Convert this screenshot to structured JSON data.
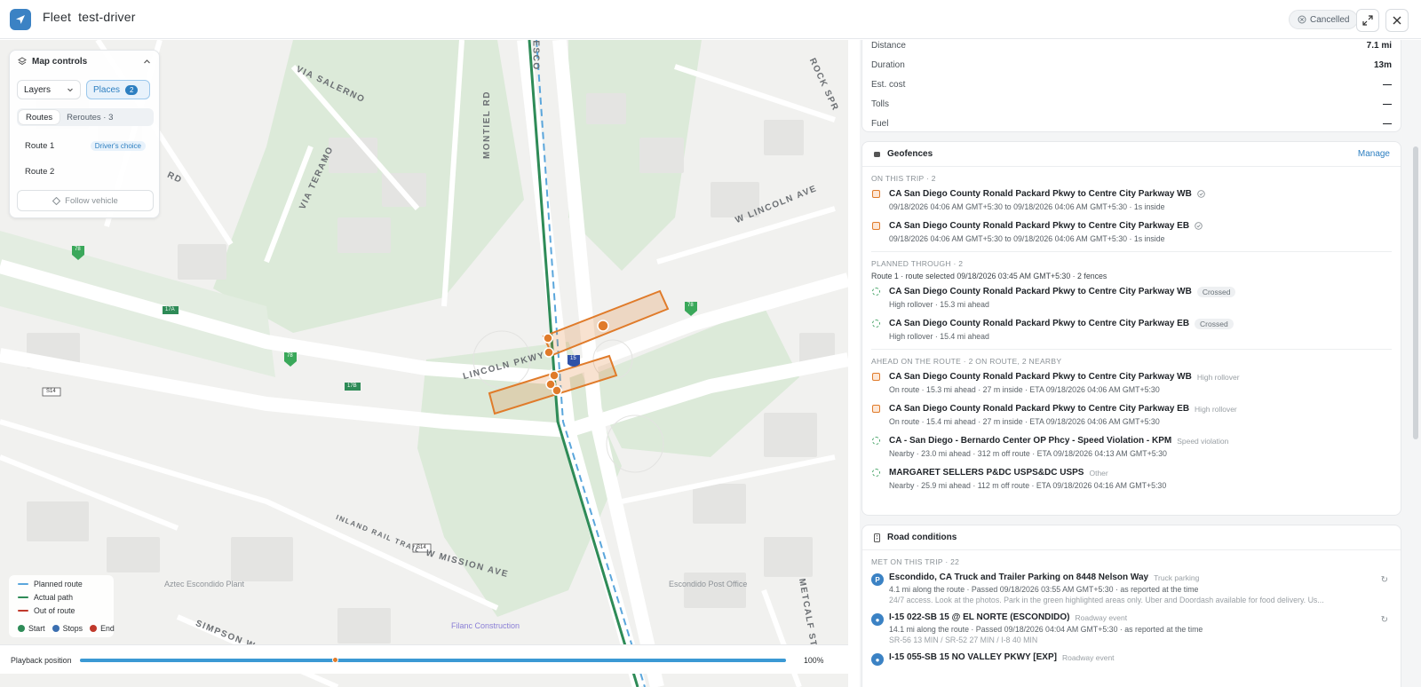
{
  "header": {
    "app": "Fleet",
    "driver": "test-driver",
    "status": "Cancelled",
    "expand_icon": "expand-icon",
    "close_icon": "close-icon"
  },
  "trip_summary": {
    "rows": [
      {
        "k": "Distance",
        "v": "7.1 mi"
      },
      {
        "k": "Duration",
        "v": "13m"
      },
      {
        "k": "Est. cost",
        "v": "—"
      },
      {
        "k": "Tolls",
        "v": "—"
      },
      {
        "k": "Fuel",
        "v": "—"
      }
    ]
  },
  "geofences": {
    "title": "Geofences",
    "manage": "Manage",
    "on_trip_label": "ON THIS TRIP · 2",
    "on_trip": [
      {
        "name": "CA San Diego County Ronald Packard Pkwy to Centre City Parkway WB",
        "detail": "09/18/2026 04:06 AM GMT+5:30 to 09/18/2026 04:06 AM GMT+5:30 · 1s inside"
      },
      {
        "name": "CA San Diego County Ronald Packard Pkwy to Centre City Parkway EB",
        "detail": "09/18/2026 04:06 AM GMT+5:30 to 09/18/2026 04:06 AM GMT+5:30 · 1s inside"
      }
    ],
    "planned_label": "PLANNED THROUGH · 2",
    "planned_note": "Route 1 · route selected 09/18/2026 03:45 AM GMT+5:30 · 2 fences",
    "planned": [
      {
        "name": "CA San Diego County Ronald Packard Pkwy to Centre City Parkway WB",
        "tag": "Crossed",
        "detail": "High rollover · 15.3 mi ahead"
      },
      {
        "name": "CA San Diego County Ronald Packard Pkwy to Centre City Parkway EB",
        "tag": "Crossed",
        "detail": "High rollover · 15.4 mi ahead"
      }
    ],
    "ahead_label": "AHEAD ON THE ROUTE · 2 ON ROUTE, 2 NEARBY",
    "ahead": [
      {
        "name": "CA San Diego County Ronald Packard Pkwy to Centre City Parkway WB",
        "tag": "High rollover",
        "detail": "On route · 15.3 mi ahead · 27 m inside · ETA 09/18/2026 04:06 AM GMT+5:30"
      },
      {
        "name": "CA San Diego County Ronald Packard Pkwy to Centre City Parkway EB",
        "tag": "High rollover",
        "detail": "On route · 15.4 mi ahead · 27 m inside · ETA 09/18/2026 04:06 AM GMT+5:30"
      },
      {
        "name": "CA - San Diego - Bernardo Center OP Phcy - Speed Violation - KPM",
        "tag": "Speed violation",
        "detail": "Nearby · 23.0 mi ahead · 312 m off route · ETA 09/18/2026 04:13 AM GMT+5:30"
      },
      {
        "name": "MARGARET SELLERS P&DC USPS&DC USPS",
        "tag": "Other",
        "detail": "Nearby · 25.9 mi ahead · 112 m off route · ETA 09/18/2026 04:16 AM GMT+5:30"
      }
    ]
  },
  "road": {
    "title": "Road conditions",
    "met_label": "MET ON THIS TRIP · 22",
    "items": [
      {
        "icon": "P",
        "name": "Escondido, CA Truck and Trailer Parking on 8448 Nelson Way",
        "tag": "Truck parking",
        "detail": "4.1 mi along the route · Passed 09/18/2026 03:55 AM GMT+5:30 · as reported at the time",
        "desc": "24/7 access. Look at the photos. Park in the green highlighted areas only. Uber and Doordash available for food delivery. Us..."
      },
      {
        "icon": "●",
        "name": "I-15 022-SB 15 @ EL NORTE (ESCONDIDO)",
        "tag": "Roadway event",
        "detail": "14.1 mi along the route · Passed 09/18/2026 04:04 AM GMT+5:30 · as reported at the time",
        "desc": "SR-56 13 MIN / SR-52 27 MIN / I-8 40 MIN"
      },
      {
        "icon": "●",
        "name": "I-15 055-SB 15 NO VALLEY PKWY [EXP]",
        "tag": "Roadway event",
        "detail": "",
        "desc": ""
      }
    ]
  },
  "map_controls": {
    "title": "Map controls",
    "layers": "Layers",
    "places": "Places",
    "places_count": "2",
    "tab_routes": "Routes",
    "tab_reroutes": "Reroutes · 3",
    "route1": "Route 1",
    "route1_tag": "Driver's choice",
    "route2": "Route 2",
    "follow": "Follow vehicle"
  },
  "legend": {
    "planned": "Planned route",
    "actual": "Actual path",
    "out": "Out of route",
    "start": "Start",
    "stops": "Stops",
    "end": "End"
  },
  "playback": {
    "label": "Playback position",
    "percent": "100%",
    "progress": 1.0
  },
  "map_labels": {
    "via_salerno": "VIA SALERNO",
    "via_teramo": "VIA TERAMO",
    "montiel": "MONTIEL RD",
    "lincoln_ave": "W LINCOLN AVE",
    "lincoln_pkwy": "LINCOLN PKWY",
    "rock_spr": "ROCK SPR",
    "mission": "W MISSION AVE",
    "inland": "INLAND RAIL TRAIL",
    "simpson": "SIMPSON W",
    "metcalf": "METCALF ST",
    "rd": "RD",
    "esco": "ESCO",
    "aztec": "Aztec Escondido Plant",
    "post": "Escondido Post Office",
    "filanc": "Filanc Construction",
    "s14a": "S14",
    "s14b": "S14",
    "r78a": "78",
    "r78b": "78",
    "r78c": "78",
    "x17a": "17A",
    "x17b": "17B",
    "i15": "15"
  },
  "colors": {
    "accent": "#2d7fc1",
    "planned": "#5aa6dc",
    "actual": "#2e8b57",
    "out": "#c0392b",
    "geofence": "#e07b2a"
  }
}
